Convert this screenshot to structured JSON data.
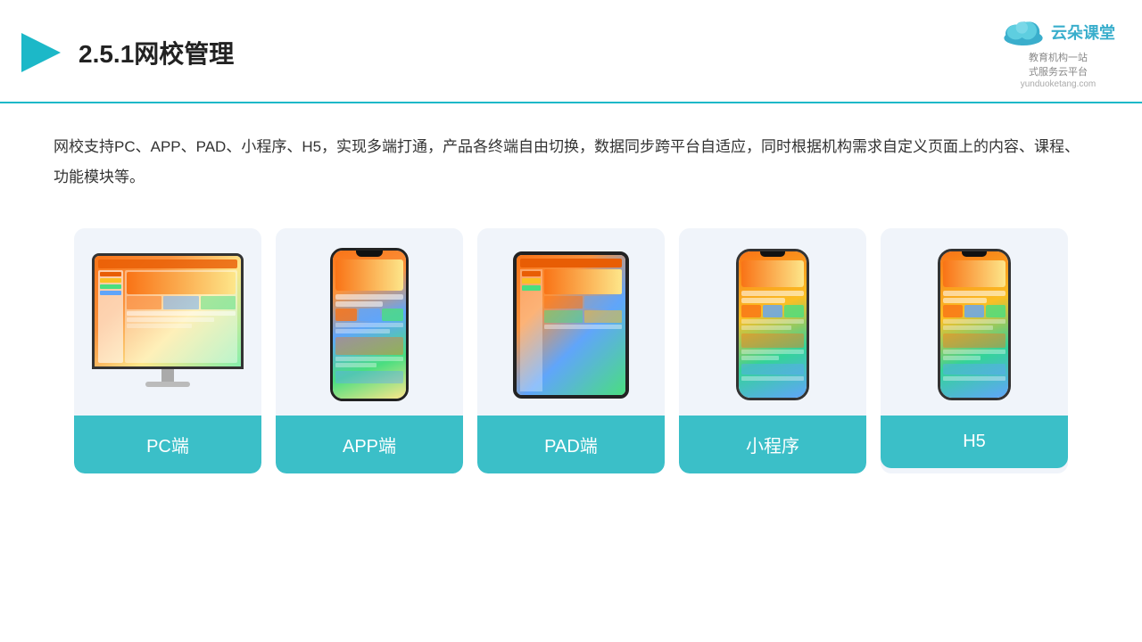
{
  "header": {
    "title": "2.5.1网校管理",
    "logo_text": "云朵课堂",
    "logo_sub": "教育机构一站\n式服务云平台",
    "logo_url": "yunduoketang.com"
  },
  "description": "网校支持PC、APP、PAD、小程序、H5，实现多端打通，产品各终端自由切换，数据同步跨平台自适应，同时根据机构需求自定义页面上的内容、课程、功能模块等。",
  "cards": [
    {
      "id": "pc",
      "label": "PC端"
    },
    {
      "id": "app",
      "label": "APP端"
    },
    {
      "id": "pad",
      "label": "PAD端"
    },
    {
      "id": "mini",
      "label": "小程序"
    },
    {
      "id": "h5",
      "label": "H5"
    }
  ],
  "accent_color": "#3bbfc8"
}
